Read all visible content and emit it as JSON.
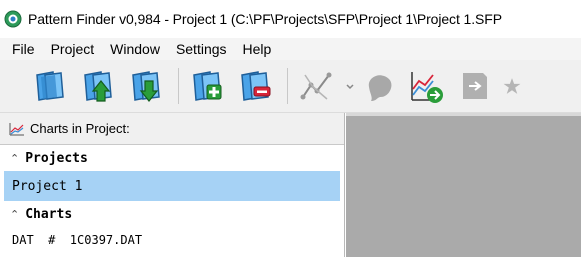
{
  "window": {
    "title": "Pattern Finder v0,984 - Project 1 (C:\\PF\\Projects\\SFP\\Project 1\\Project 1.SFP"
  },
  "menu": {
    "items": [
      {
        "label": "File"
      },
      {
        "label": "Project"
      },
      {
        "label": "Window"
      },
      {
        "label": "Settings"
      },
      {
        "label": "Help"
      }
    ]
  },
  "toolbar": {
    "buttons": [
      {
        "icon": "open-project-icon"
      },
      {
        "icon": "upload-project-icon"
      },
      {
        "icon": "download-project-icon"
      },
      {
        "icon": "add-chart-icon"
      },
      {
        "icon": "remove-chart-icon"
      },
      {
        "icon": "pattern-tool-icon"
      },
      {
        "icon": "blob-tool-icon"
      },
      {
        "icon": "chart-export-icon"
      },
      {
        "icon": "export-arrow-icon"
      },
      {
        "icon": "star-icon"
      }
    ]
  },
  "panel": {
    "header": "Charts in Project:",
    "projects_group": "Projects",
    "project_item": "Project 1",
    "charts_group": "Charts",
    "chart_item": "DAT  #  1C0397.DAT"
  },
  "colors": {
    "selection": "#a6d2f5",
    "main_background": "#aaaaaa",
    "toolbar_icon_blue": "#3a8fd6",
    "toolbar_icon_green": "#2a9d3a",
    "toolbar_icon_red": "#d8253a"
  }
}
